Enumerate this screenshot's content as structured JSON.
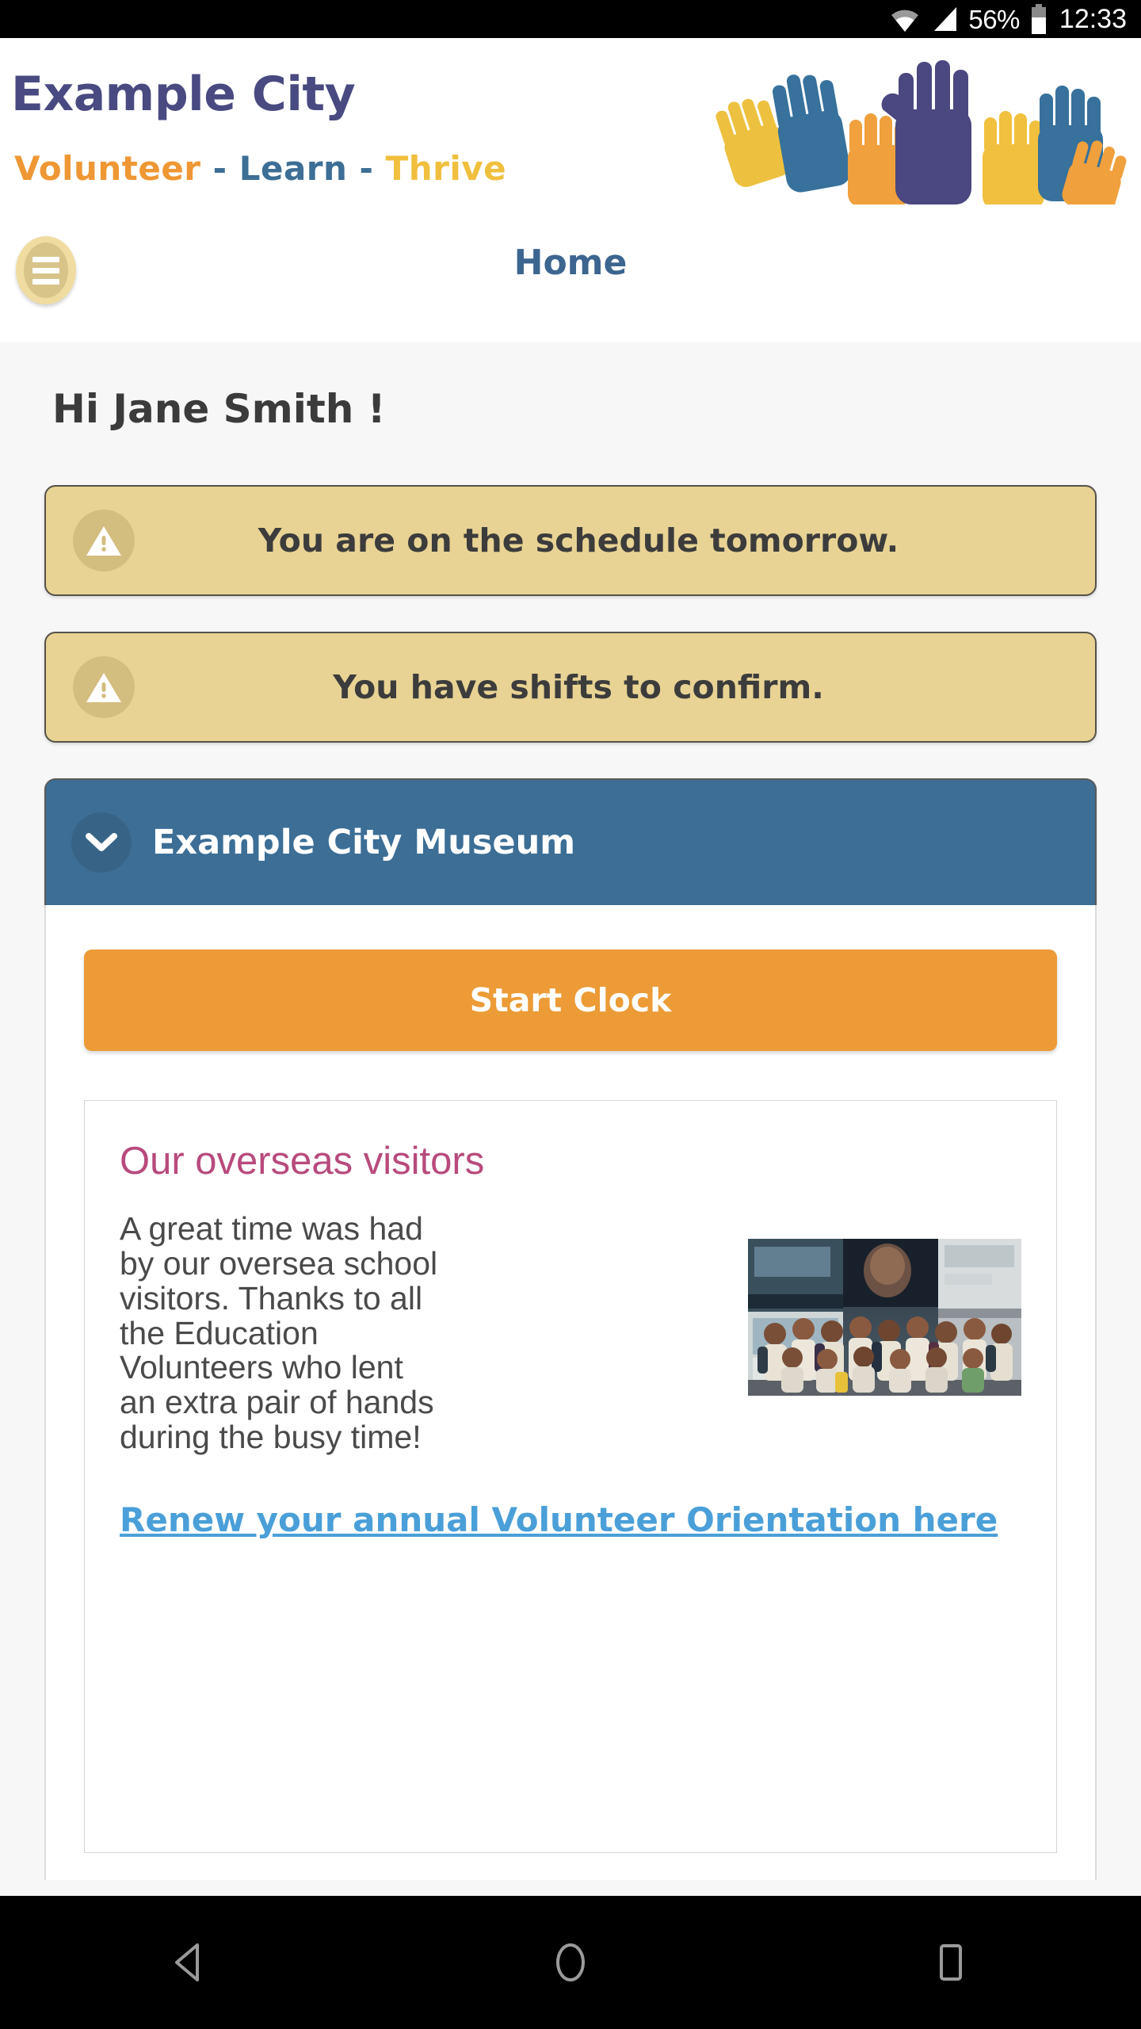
{
  "status_bar": {
    "battery_percent": "56%",
    "time": "12:33",
    "icons": [
      "wifi-icon",
      "cell-signal-icon",
      "battery-icon"
    ]
  },
  "header": {
    "brand_name": "Example City",
    "tagline": {
      "word1": "Volunteer",
      "sep1": " - ",
      "word2": "Learn",
      "sep2": " - ",
      "word3": "Thrive"
    },
    "menu_button_label": "menu",
    "page_title": "Home",
    "logo_alt": "raised-hands-logo"
  },
  "main": {
    "greeting": "Hi Jane Smith !",
    "alerts": [
      {
        "text": "You are on the schedule tomorrow.",
        "icon": "warning-icon"
      },
      {
        "text": "You have shifts to confirm.",
        "icon": "warning-icon"
      }
    ],
    "accordion": {
      "title": "Example City Museum",
      "chevron": "chevron-down-icon",
      "expanded": true,
      "start_clock_label": "Start Clock",
      "news": {
        "title": "Our overseas visitors",
        "body": "A great time was had\nby our oversea school\nvisitors.  Thanks to all\nthe Education\nVolunteers who lent\nan extra pair of hands\nduring the busy time!",
        "photo_alt": "school-group-photo",
        "link_text": "Renew your annual Volunteer Orientation here"
      }
    }
  },
  "nav_bar": {
    "back_label": "back-icon",
    "home_label": "home-icon",
    "recents_label": "recents-icon"
  },
  "colors": {
    "brand_purple": "#4a4a82",
    "brand_orange": "#ef9734",
    "brand_blue": "#3c6e96",
    "brand_yellow": "#f0bf3e",
    "alert_bg": "#e8d394",
    "accent_orange": "#ec9b36",
    "news_title": "#b84a7c",
    "link_blue": "#4a9fd8"
  }
}
